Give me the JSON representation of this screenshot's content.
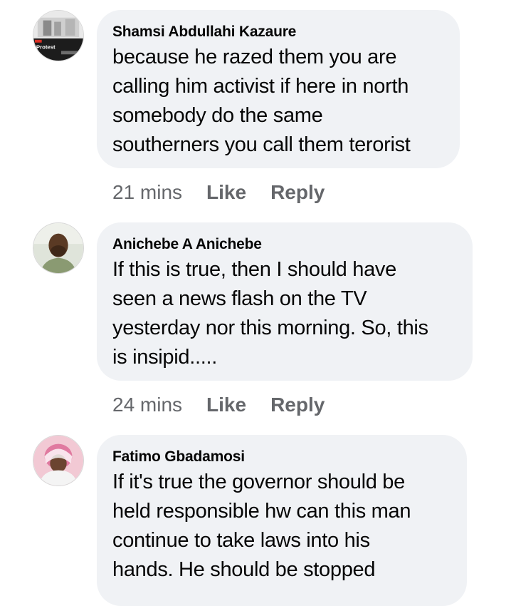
{
  "comments": [
    {
      "author": "Shamsi Abdullahi Kazaure",
      "lines": [
        "because he razed them you are",
        "calling him activist if here in north",
        "somebody do the same",
        "southerners you call them terorist"
      ],
      "time": "21 mins",
      "like_label": "Like",
      "reply_label": "Reply",
      "avatar_text": "Protest"
    },
    {
      "author": "Anichebe A Anichebe",
      "lines": [
        "If this is true, then I should have",
        "seen a news flash on the TV",
        "yesterday nor this morning. So, this",
        "is insipid....."
      ],
      "time": "24 mins",
      "like_label": "Like",
      "reply_label": "Reply"
    },
    {
      "author": "Fatimo Gbadamosi",
      "lines": [
        "If it's true the governor should be",
        "held responsible hw can this man",
        "continue to take laws into his",
        "hands. He should be stopped"
      ]
    }
  ],
  "colors": {
    "bubble": "#f0f2f5",
    "meta": "#65676b",
    "text": "#050505"
  }
}
